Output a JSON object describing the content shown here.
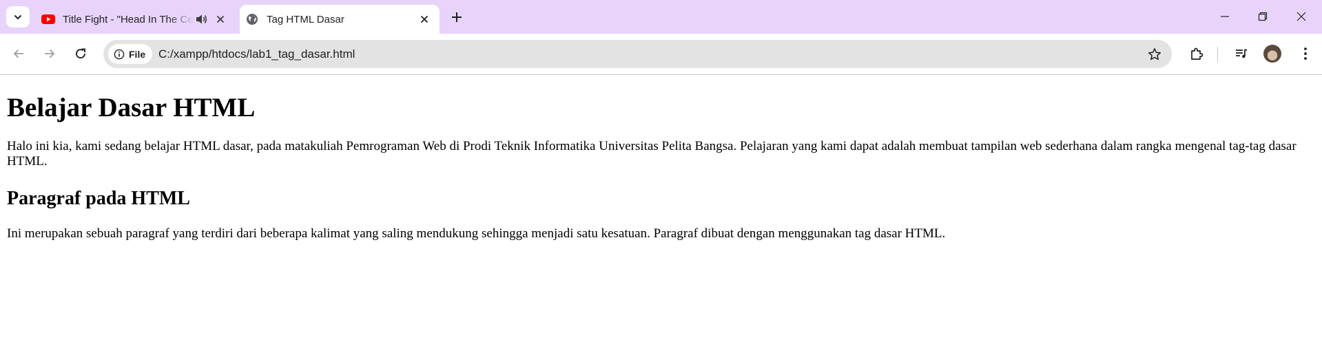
{
  "tabs": [
    {
      "title": "Title Fight - \"Head In The Ceiling Fan\"",
      "favicon": "youtube-icon",
      "audible": true,
      "active": false
    },
    {
      "title": "Tag HTML Dasar",
      "favicon": "globe-icon",
      "active": true
    }
  ],
  "toolbar": {
    "scheme_chip": "File",
    "url": "C:/xampp/htdocs/lab1_tag_dasar.html"
  },
  "page": {
    "heading": "Belajar Dasar HTML",
    "intro": "Halo ini kia, kami sedang belajar HTML dasar, pada matakuliah Pemrograman Web di Prodi Teknik Informatika Universitas Pelita Bangsa. Pelajaran yang kami dapat adalah membuat tampilan web sederhana dalam rangka mengenal tag-tag dasar HTML.",
    "subheading": "Paragraf pada HTML",
    "paragraph": "Ini merupakan sebuah paragraf yang terdiri dari beberapa kalimat yang saling mendukung sehingga menjadi satu kesatuan. Paragraf dibuat dengan menggunakan tag dasar HTML."
  },
  "colors": {
    "tabstrip": "#e8d4fb",
    "omnibox": "#e3e3e3",
    "youtube_red": "#ff0000"
  }
}
